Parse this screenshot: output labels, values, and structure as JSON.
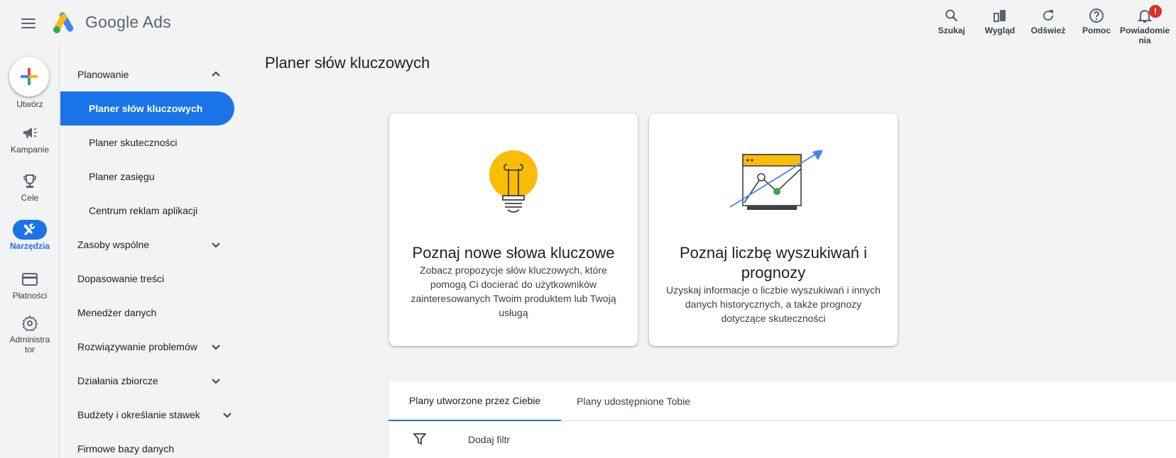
{
  "header": {
    "brand_google": "Google",
    "brand_ads": "Ads",
    "actions": [
      {
        "label": "Szukaj",
        "icon": "search-icon"
      },
      {
        "label": "Wygląd",
        "icon": "appearance-icon"
      },
      {
        "label": "Odśwież",
        "icon": "refresh-icon"
      },
      {
        "label": "Pomoc",
        "icon": "help-icon"
      },
      {
        "label": "Powiadomie nia",
        "icon": "bell-icon",
        "badge": "!"
      }
    ]
  },
  "rail": {
    "create_label": "Utwórz",
    "items": [
      {
        "label": "Kampanie",
        "icon": "campaign-icon"
      },
      {
        "label": "Cele",
        "icon": "trophy-icon"
      },
      {
        "label": "Narzędzia",
        "icon": "tools-icon",
        "active": true
      },
      {
        "label": "Płatności",
        "icon": "card-icon"
      },
      {
        "label": "Administra tor",
        "icon": "gear-icon"
      }
    ]
  },
  "nav": {
    "items": [
      {
        "label": "Planowanie",
        "level": 1,
        "chevron": "up"
      },
      {
        "label": "Planer słów kluczowych",
        "level": 2,
        "selected": true
      },
      {
        "label": "Planer skuteczności",
        "level": 2
      },
      {
        "label": "Planer zasięgu",
        "level": 2
      },
      {
        "label": "Centrum reklam aplikacji",
        "level": 2
      },
      {
        "label": "Zasoby wspólne",
        "level": 1,
        "chevron": "down"
      },
      {
        "label": "Dopasowanie treści",
        "level": 1
      },
      {
        "label": "Menedżer danych",
        "level": 1
      },
      {
        "label": "Rozwiązywanie problemów",
        "level": 1,
        "chevron": "down"
      },
      {
        "label": "Działania zbiorcze",
        "level": 1,
        "chevron": "down"
      },
      {
        "label": "Budżety i określanie stawek",
        "level": 1,
        "chevron": "down"
      },
      {
        "label": "Firmowe bazy danych",
        "level": 1
      }
    ]
  },
  "main": {
    "title": "Planer słów kluczowych",
    "cards": [
      {
        "title": "Poznaj nowe słowa kluczowe",
        "description": "Zobacz propozycje słów kluczowych, które pomogą Ci docierać do użytkowników zainteresowanych Twoim produktem lub Twoją usługą"
      },
      {
        "title": "Poznaj liczbę wyszukiwań i prognozy",
        "description": "Uzyskaj informacje o liczbie wyszukiwań i innych danych historycznych, a także prognozy dotyczące skuteczności"
      }
    ],
    "tabs": [
      "Plany utworzone przez Ciebie",
      "Plany udostępnione Tobie"
    ],
    "filter_label": "Dodaj filtr"
  },
  "colors": {
    "accent": "#1a73e8",
    "background": "#f1f3f4",
    "bulb": "#fbbc04",
    "green": "#34a853",
    "badge": "#d93025"
  }
}
